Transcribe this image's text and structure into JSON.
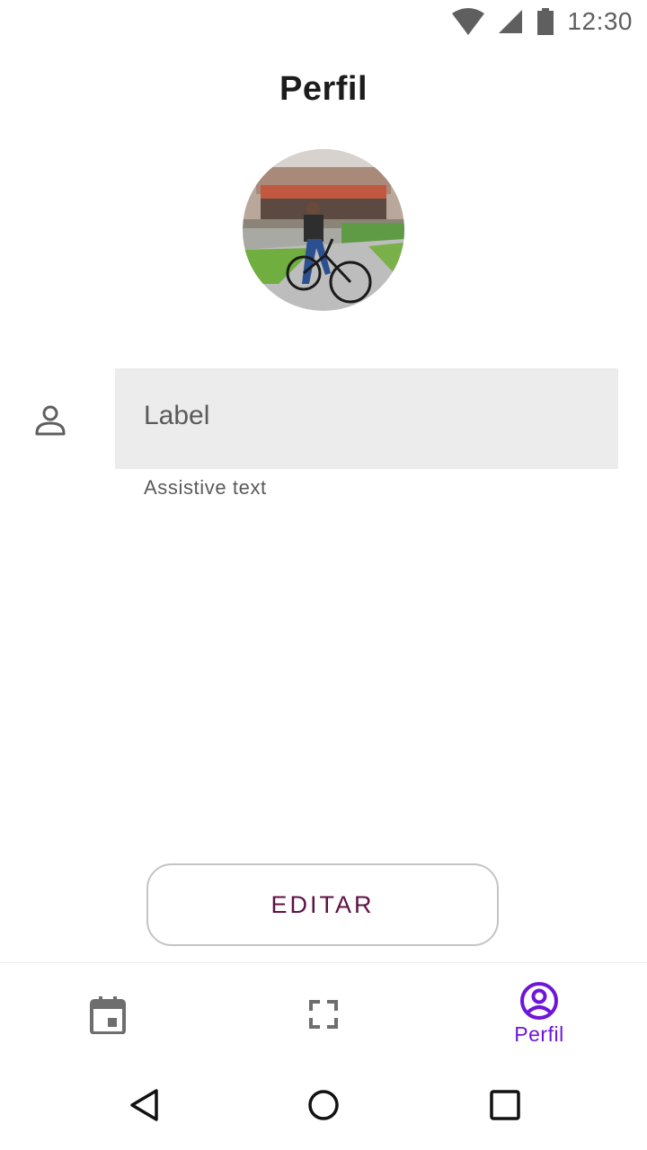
{
  "status_bar": {
    "time": "12:30",
    "icons": [
      "wifi-icon",
      "cellular-signal-icon",
      "battery-icon"
    ]
  },
  "header": {
    "title": "Perfil"
  },
  "profile": {
    "avatar": "profile-photo"
  },
  "form": {
    "field_icon": "person-icon",
    "field_label": "Label",
    "assistive_text": "Assistive text"
  },
  "actions": {
    "edit_label": "EDITAR"
  },
  "bottom_nav": {
    "items": [
      {
        "icon": "calendar-icon",
        "label": "",
        "active": false
      },
      {
        "icon": "scan-frame-icon",
        "label": "",
        "active": false
      },
      {
        "icon": "account-circle-icon",
        "label": "Perfil",
        "active": true
      }
    ],
    "active_color": "#6d16d8"
  },
  "system_nav": {
    "buttons": [
      "back-icon",
      "home-icon",
      "recents-icon"
    ]
  },
  "colors": {
    "accent": "#6d16d8",
    "button_text": "#5c1245",
    "field_background": "#ececec"
  }
}
